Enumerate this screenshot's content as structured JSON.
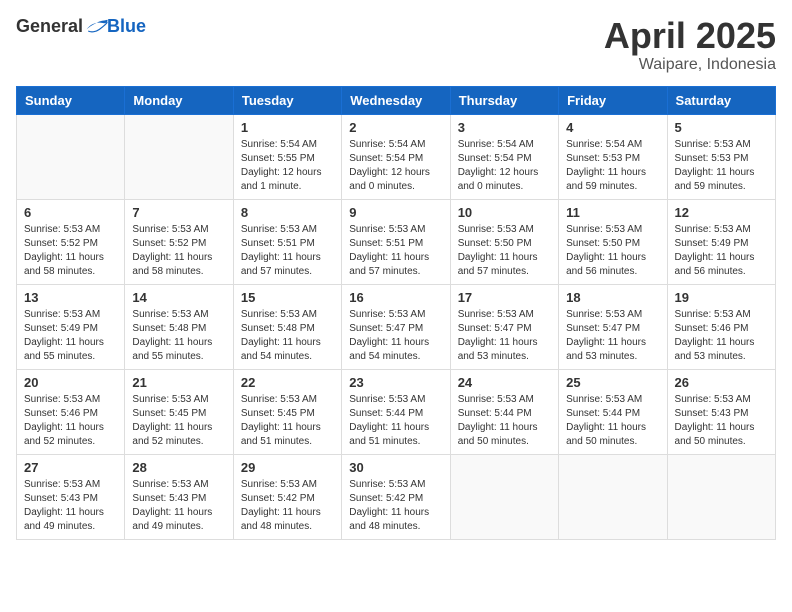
{
  "logo": {
    "general": "General",
    "blue": "Blue"
  },
  "title": "April 2025",
  "location": "Waipare, Indonesia",
  "days_header": [
    "Sunday",
    "Monday",
    "Tuesday",
    "Wednesday",
    "Thursday",
    "Friday",
    "Saturday"
  ],
  "weeks": [
    [
      {
        "day": "",
        "info": ""
      },
      {
        "day": "",
        "info": ""
      },
      {
        "day": "1",
        "info": "Sunrise: 5:54 AM\nSunset: 5:55 PM\nDaylight: 12 hours and 1 minute."
      },
      {
        "day": "2",
        "info": "Sunrise: 5:54 AM\nSunset: 5:54 PM\nDaylight: 12 hours and 0 minutes."
      },
      {
        "day": "3",
        "info": "Sunrise: 5:54 AM\nSunset: 5:54 PM\nDaylight: 12 hours and 0 minutes."
      },
      {
        "day": "4",
        "info": "Sunrise: 5:54 AM\nSunset: 5:53 PM\nDaylight: 11 hours and 59 minutes."
      },
      {
        "day": "5",
        "info": "Sunrise: 5:53 AM\nSunset: 5:53 PM\nDaylight: 11 hours and 59 minutes."
      }
    ],
    [
      {
        "day": "6",
        "info": "Sunrise: 5:53 AM\nSunset: 5:52 PM\nDaylight: 11 hours and 58 minutes."
      },
      {
        "day": "7",
        "info": "Sunrise: 5:53 AM\nSunset: 5:52 PM\nDaylight: 11 hours and 58 minutes."
      },
      {
        "day": "8",
        "info": "Sunrise: 5:53 AM\nSunset: 5:51 PM\nDaylight: 11 hours and 57 minutes."
      },
      {
        "day": "9",
        "info": "Sunrise: 5:53 AM\nSunset: 5:51 PM\nDaylight: 11 hours and 57 minutes."
      },
      {
        "day": "10",
        "info": "Sunrise: 5:53 AM\nSunset: 5:50 PM\nDaylight: 11 hours and 57 minutes."
      },
      {
        "day": "11",
        "info": "Sunrise: 5:53 AM\nSunset: 5:50 PM\nDaylight: 11 hours and 56 minutes."
      },
      {
        "day": "12",
        "info": "Sunrise: 5:53 AM\nSunset: 5:49 PM\nDaylight: 11 hours and 56 minutes."
      }
    ],
    [
      {
        "day": "13",
        "info": "Sunrise: 5:53 AM\nSunset: 5:49 PM\nDaylight: 11 hours and 55 minutes."
      },
      {
        "day": "14",
        "info": "Sunrise: 5:53 AM\nSunset: 5:48 PM\nDaylight: 11 hours and 55 minutes."
      },
      {
        "day": "15",
        "info": "Sunrise: 5:53 AM\nSunset: 5:48 PM\nDaylight: 11 hours and 54 minutes."
      },
      {
        "day": "16",
        "info": "Sunrise: 5:53 AM\nSunset: 5:47 PM\nDaylight: 11 hours and 54 minutes."
      },
      {
        "day": "17",
        "info": "Sunrise: 5:53 AM\nSunset: 5:47 PM\nDaylight: 11 hours and 53 minutes."
      },
      {
        "day": "18",
        "info": "Sunrise: 5:53 AM\nSunset: 5:47 PM\nDaylight: 11 hours and 53 minutes."
      },
      {
        "day": "19",
        "info": "Sunrise: 5:53 AM\nSunset: 5:46 PM\nDaylight: 11 hours and 53 minutes."
      }
    ],
    [
      {
        "day": "20",
        "info": "Sunrise: 5:53 AM\nSunset: 5:46 PM\nDaylight: 11 hours and 52 minutes."
      },
      {
        "day": "21",
        "info": "Sunrise: 5:53 AM\nSunset: 5:45 PM\nDaylight: 11 hours and 52 minutes."
      },
      {
        "day": "22",
        "info": "Sunrise: 5:53 AM\nSunset: 5:45 PM\nDaylight: 11 hours and 51 minutes."
      },
      {
        "day": "23",
        "info": "Sunrise: 5:53 AM\nSunset: 5:44 PM\nDaylight: 11 hours and 51 minutes."
      },
      {
        "day": "24",
        "info": "Sunrise: 5:53 AM\nSunset: 5:44 PM\nDaylight: 11 hours and 50 minutes."
      },
      {
        "day": "25",
        "info": "Sunrise: 5:53 AM\nSunset: 5:44 PM\nDaylight: 11 hours and 50 minutes."
      },
      {
        "day": "26",
        "info": "Sunrise: 5:53 AM\nSunset: 5:43 PM\nDaylight: 11 hours and 50 minutes."
      }
    ],
    [
      {
        "day": "27",
        "info": "Sunrise: 5:53 AM\nSunset: 5:43 PM\nDaylight: 11 hours and 49 minutes."
      },
      {
        "day": "28",
        "info": "Sunrise: 5:53 AM\nSunset: 5:43 PM\nDaylight: 11 hours and 49 minutes."
      },
      {
        "day": "29",
        "info": "Sunrise: 5:53 AM\nSunset: 5:42 PM\nDaylight: 11 hours and 48 minutes."
      },
      {
        "day": "30",
        "info": "Sunrise: 5:53 AM\nSunset: 5:42 PM\nDaylight: 11 hours and 48 minutes."
      },
      {
        "day": "",
        "info": ""
      },
      {
        "day": "",
        "info": ""
      },
      {
        "day": "",
        "info": ""
      }
    ]
  ]
}
